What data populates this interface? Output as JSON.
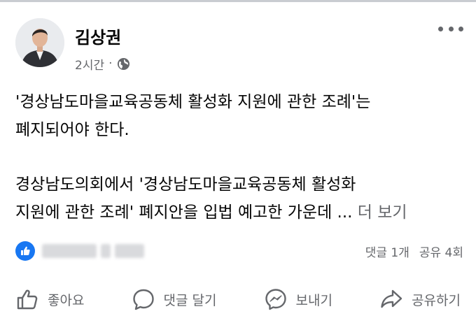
{
  "post": {
    "author": "김상권",
    "time": "2시간",
    "separator": "·",
    "body": {
      "line1": "'경상남도마을교육공동체 활성화 지원에 관한 조례'는",
      "line2": "폐지되어야 한다.",
      "line3": " 경상남도의회에서 '경상남도마을교육공동체 활성화",
      "line4": "지원에 관한 조례' 폐지안을 입법 예고한 가운데 ...",
      "see_more": "더 보기"
    },
    "stats": {
      "comments": "댓글 1개",
      "shares": "공유 4회"
    },
    "actions": {
      "like": "좋아요",
      "comment": "댓글 달기",
      "send": "보내기",
      "share": "공유하기"
    }
  },
  "colors": {
    "like_blue": "#1877f2",
    "secondary_text": "#65676b",
    "primary_text": "#050505"
  },
  "icons": [
    "globe-icon",
    "more-icon",
    "like-reaction-icon",
    "thumbs-up-icon",
    "comment-icon",
    "messenger-icon",
    "share-icon"
  ]
}
